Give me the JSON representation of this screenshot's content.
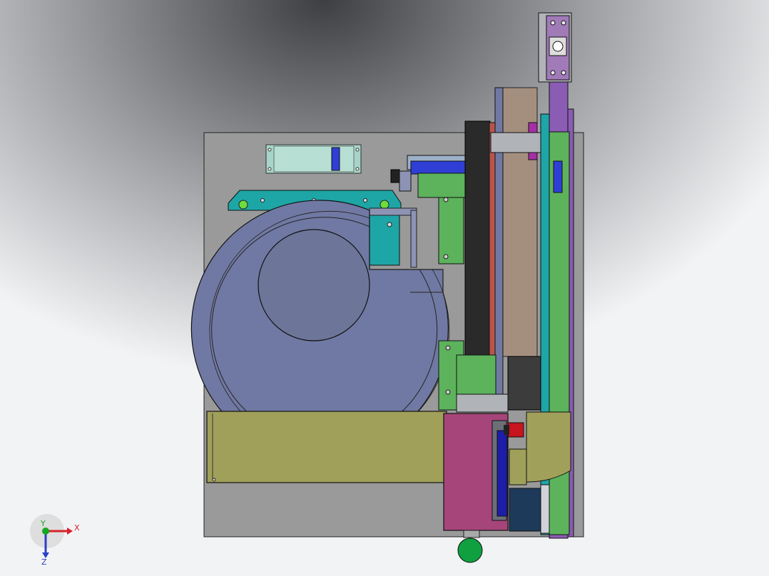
{
  "viewport": {
    "background_gradient": [
      "#3d3f43",
      "#f2f3f5"
    ]
  },
  "colors": {
    "plate": "#9a9a9a",
    "bowl": "#7079a3",
    "bowl_inner": "#6d7599",
    "linear_feeder": "#a0a05a",
    "teal_bracket": "#1ea5a6",
    "green_part": "#5cb35c",
    "purple_rail": "#8a5cb3",
    "magenta_box": "#a6457a",
    "tan_plate": "#a48f7f",
    "black_column": "#2a2a2a",
    "blue_comb": "#2f3fd6",
    "label_box": "#a7d4c8",
    "emergency_red": "#c8141e",
    "knob_green": "#10a040"
  },
  "triad": {
    "x_label": "X",
    "y_label": "Y",
    "z_label": "Z",
    "x_color": "#d6222a",
    "y_color": "#16a822",
    "z_color": "#2a40c8"
  }
}
